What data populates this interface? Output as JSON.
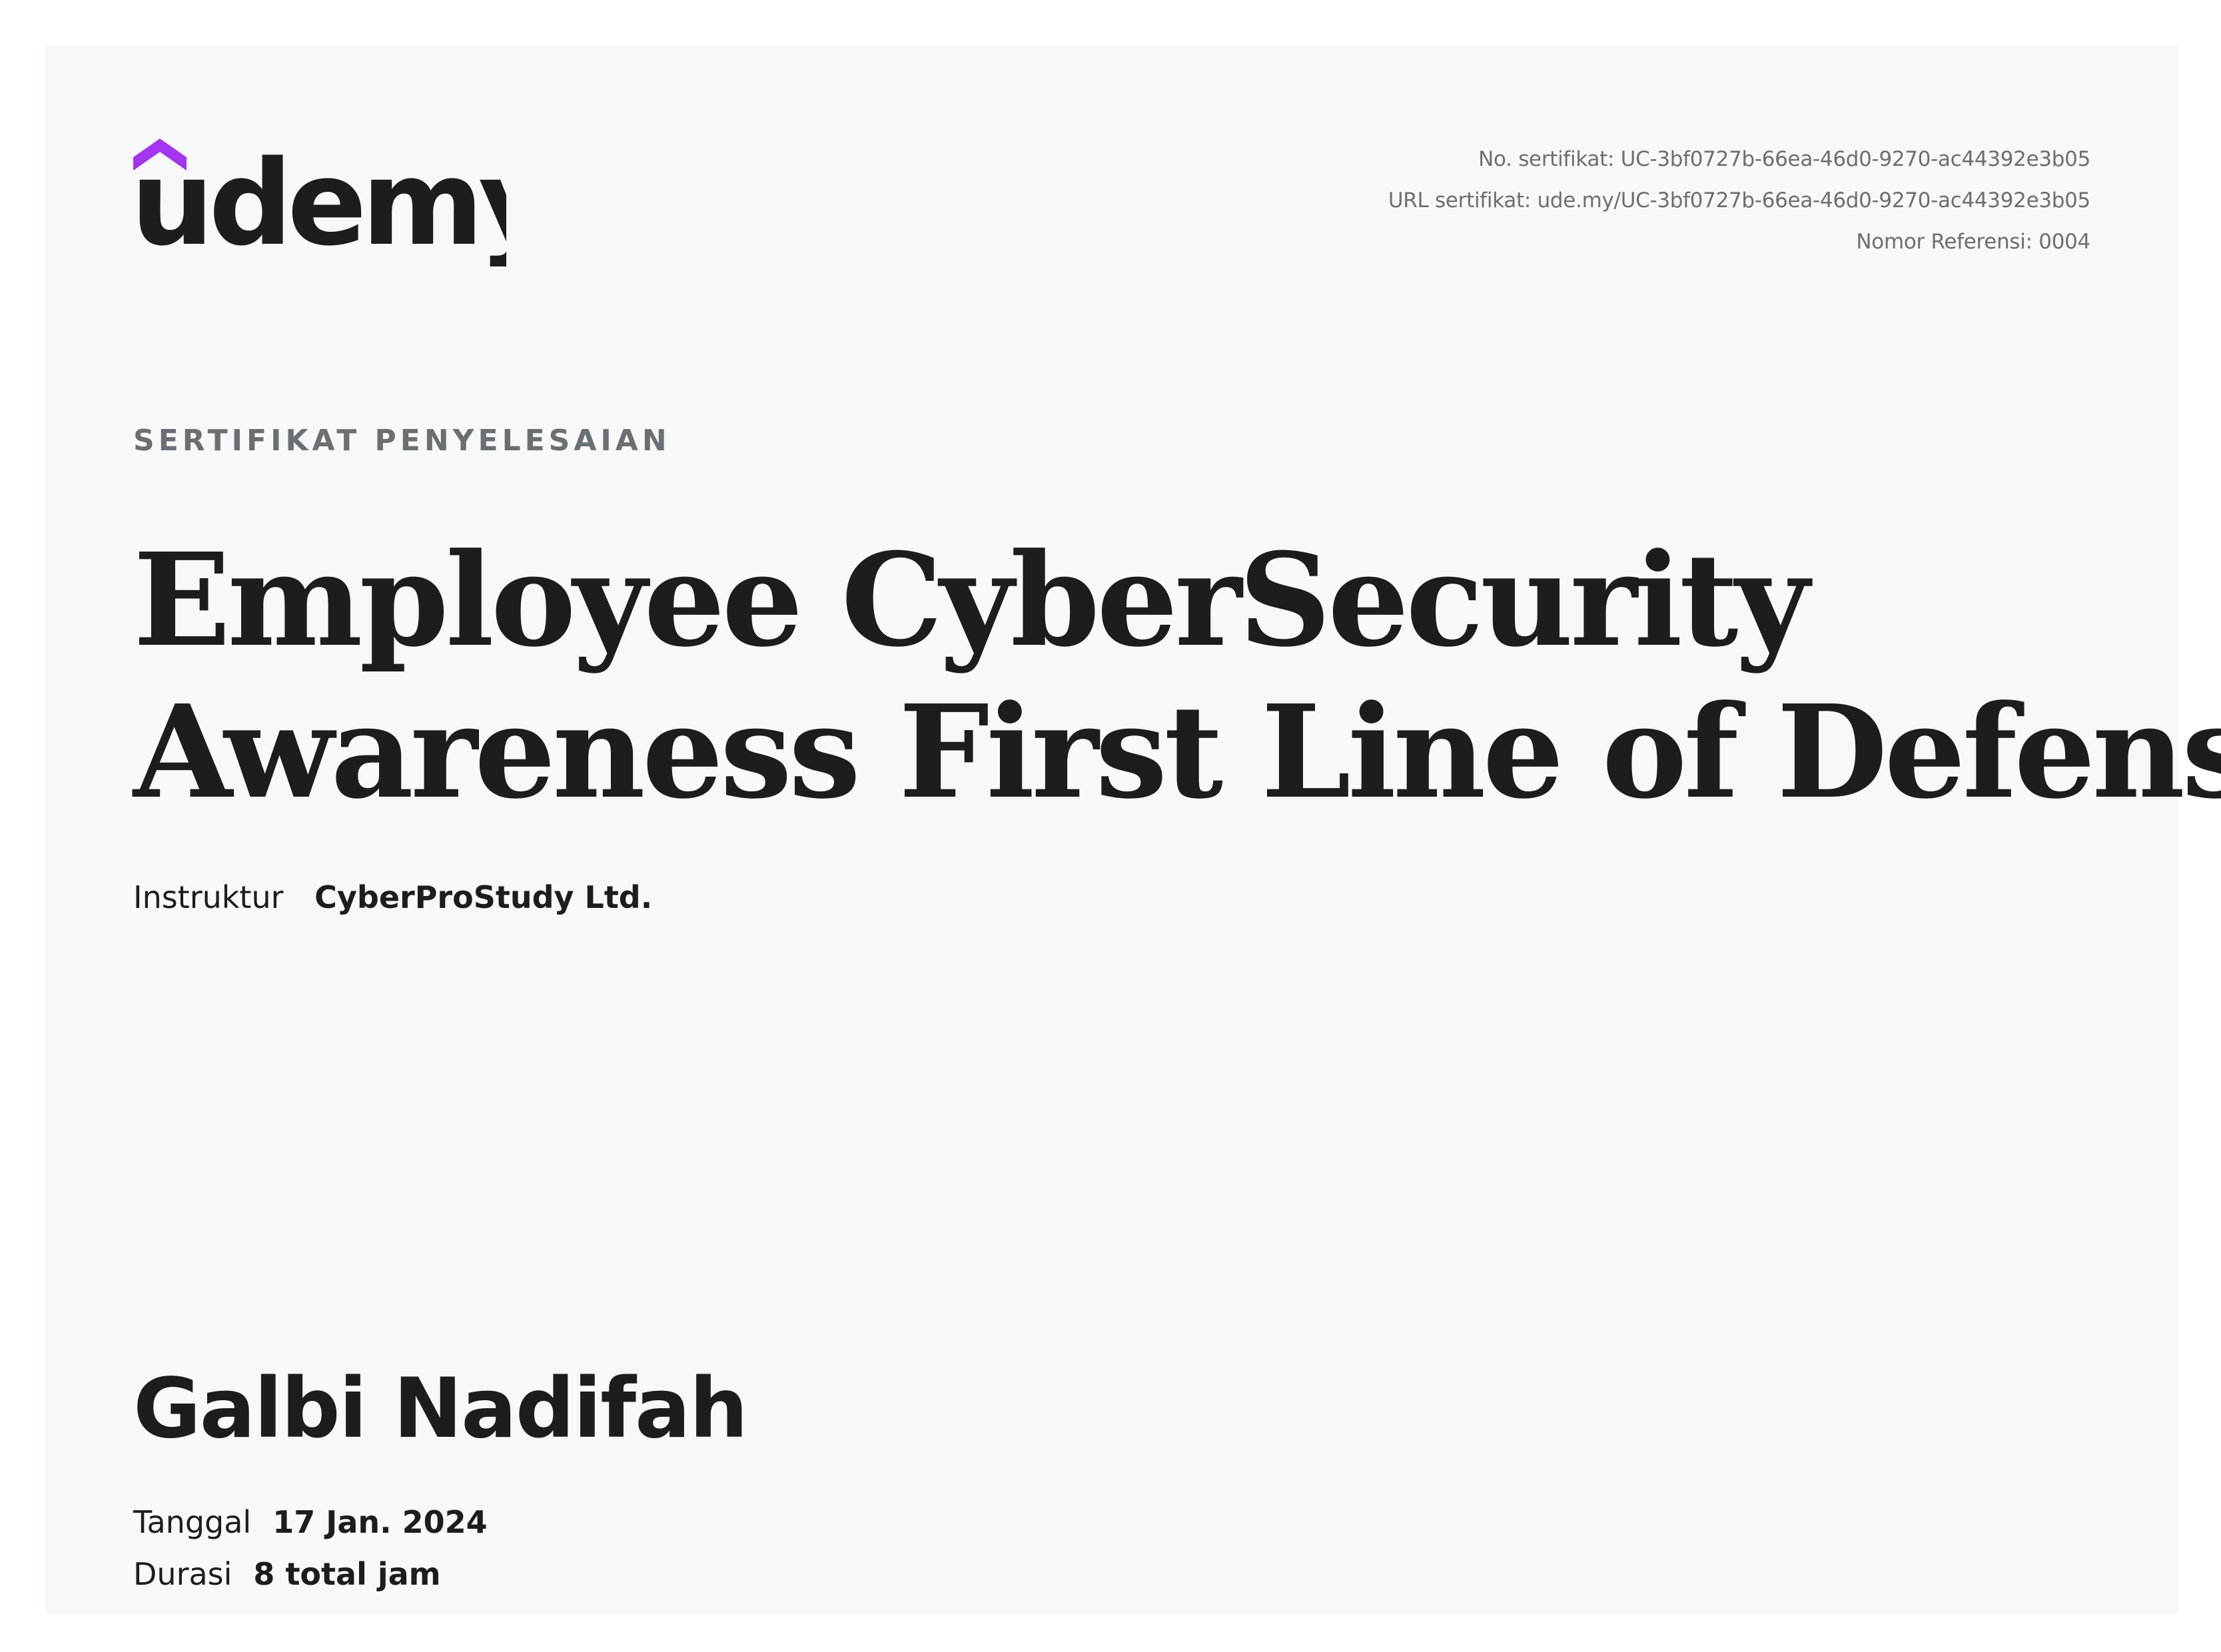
{
  "brand": {
    "name": "udemy",
    "accent_color": "#a435f0",
    "text_color": "#1c1d1f"
  },
  "meta": {
    "certificate_no": "No. sertifikat: UC-3bf0727b-66ea-46d0-9270-ac44392e3b05",
    "certificate_url": "URL sertifikat: ude.my/UC-3bf0727b-66ea-46d0-9270-ac44392e3b05",
    "reference_no": "Nomor Referensi: 0004"
  },
  "eyebrow": "SERTIFIKAT PENYELESAIAN",
  "course": {
    "title_line1": "Employee CyberSecurity",
    "title_line2": "Awareness First Line of Defense"
  },
  "instructor": {
    "label": "Instruktur",
    "name": "CyberProStudy Ltd."
  },
  "recipient": {
    "name": "Galbi Nadifah"
  },
  "details": {
    "date_label": "Tanggal",
    "date_value": "17 Jan. 2024",
    "duration_label": "Durasi",
    "duration_value": "8 total jam"
  }
}
